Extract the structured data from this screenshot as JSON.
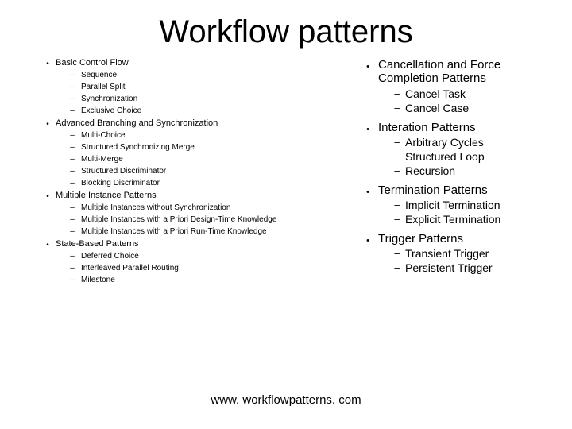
{
  "title": "Workflow patterns",
  "footer": "www. workflowpatterns. com",
  "left": [
    {
      "label": "Basic Control Flow",
      "items": [
        "Sequence",
        "Parallel Split",
        "Synchronization",
        "Exclusive Choice"
      ]
    },
    {
      "label": "Advanced Branching and Synchronization",
      "items": [
        "Multi-Choice",
        "Structured Synchronizing Merge",
        "Multi-Merge",
        "Structured Discriminator",
        "Blocking Discriminator"
      ]
    },
    {
      "label": "Multiple Instance Patterns",
      "items": [
        "Multiple Instances without Synchronization",
        "Multiple Instances with a Priori Design-Time Knowledge",
        "Multiple Instances with a Priori Run-Time Knowledge"
      ]
    },
    {
      "label": "State-Based Patterns",
      "items": [
        "Deferred Choice",
        "Interleaved Parallel Routing",
        "Milestone"
      ]
    }
  ],
  "right": [
    {
      "label": "Cancellation and Force Completion Patterns",
      "items": [
        "Cancel Task",
        "Cancel Case"
      ]
    },
    {
      "label": "Interation Patterns",
      "items": [
        "Arbitrary Cycles",
        "Structured Loop",
        "Recursion"
      ]
    },
    {
      "label": "Termination Patterns",
      "items": [
        "Implicit Termination",
        "Explicit Termination"
      ]
    },
    {
      "label": "Trigger Patterns",
      "items": [
        "Transient Trigger",
        "Persistent Trigger"
      ]
    }
  ]
}
